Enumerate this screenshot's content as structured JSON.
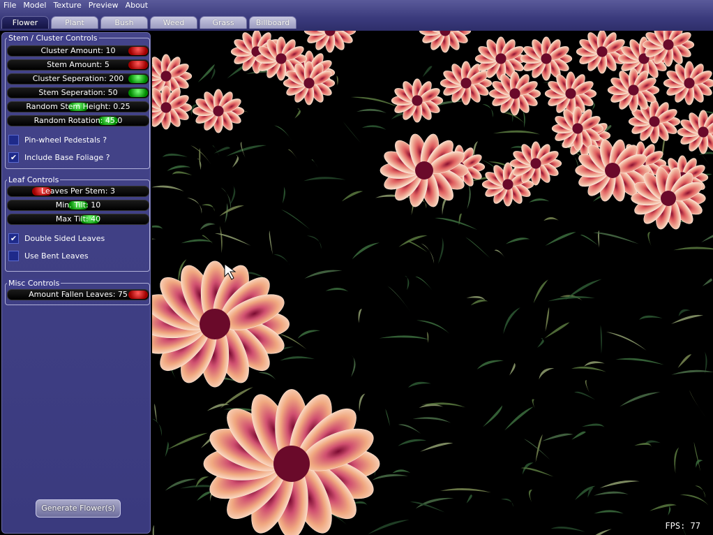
{
  "menu": [
    "File",
    "Model",
    "Texture",
    "Preview",
    "About"
  ],
  "tabs": [
    {
      "label": "Flower",
      "active": true
    },
    {
      "label": "Plant"
    },
    {
      "label": "Bush"
    },
    {
      "label": "Weed"
    },
    {
      "label": "Grass"
    },
    {
      "label": "Billboard"
    }
  ],
  "stem_cluster": {
    "title": "Stem / Cluster Controls",
    "sliders": [
      {
        "label": "Cluster Amount: 10",
        "level": 1.0,
        "color": "red"
      },
      {
        "label": "Stem Amount: 5",
        "level": 1.0,
        "color": "red"
      },
      {
        "label": "Cluster Seperation: 200",
        "level": 1.0,
        "color": "green"
      },
      {
        "label": "Stem Seperation: 50",
        "level": 1.0,
        "color": "green"
      },
      {
        "label": "Random Stem Height: 0.25",
        "level": 0.5,
        "color": "green"
      },
      {
        "label": "Random Rotation: 45.0",
        "level": 0.75,
        "color": "green"
      }
    ],
    "checks": [
      {
        "label": "Pin-wheel Pedestals ?",
        "checked": false
      },
      {
        "label": "Include Base Foliage ?",
        "checked": true
      }
    ]
  },
  "leaf": {
    "title": "Leaf Controls",
    "sliders": [
      {
        "label": "Leaves Per Stem: 3",
        "level": 0.2,
        "color": "red"
      },
      {
        "label": "Min. Tilt: 10",
        "level": 0.5,
        "color": "green"
      },
      {
        "label": "Max Tilt: 40",
        "level": 0.6,
        "color": "green"
      }
    ],
    "checks": [
      {
        "label": "Double Sided Leaves",
        "checked": true
      },
      {
        "label": "Use Bent Leaves",
        "checked": false
      }
    ]
  },
  "misc": {
    "title": "Misc Controls",
    "sliders": [
      {
        "label": "Amount Fallen Leaves: 75",
        "level": 1.0,
        "color": "red"
      }
    ]
  },
  "generate_label": "Generate Flower(s)",
  "fps": "FPS: 77",
  "colors": {
    "panel": "#3e3e84",
    "slider_red": "#d01010",
    "slider_green": "#10b010",
    "petal": "#e88878",
    "foliage": "#2e5a34"
  }
}
